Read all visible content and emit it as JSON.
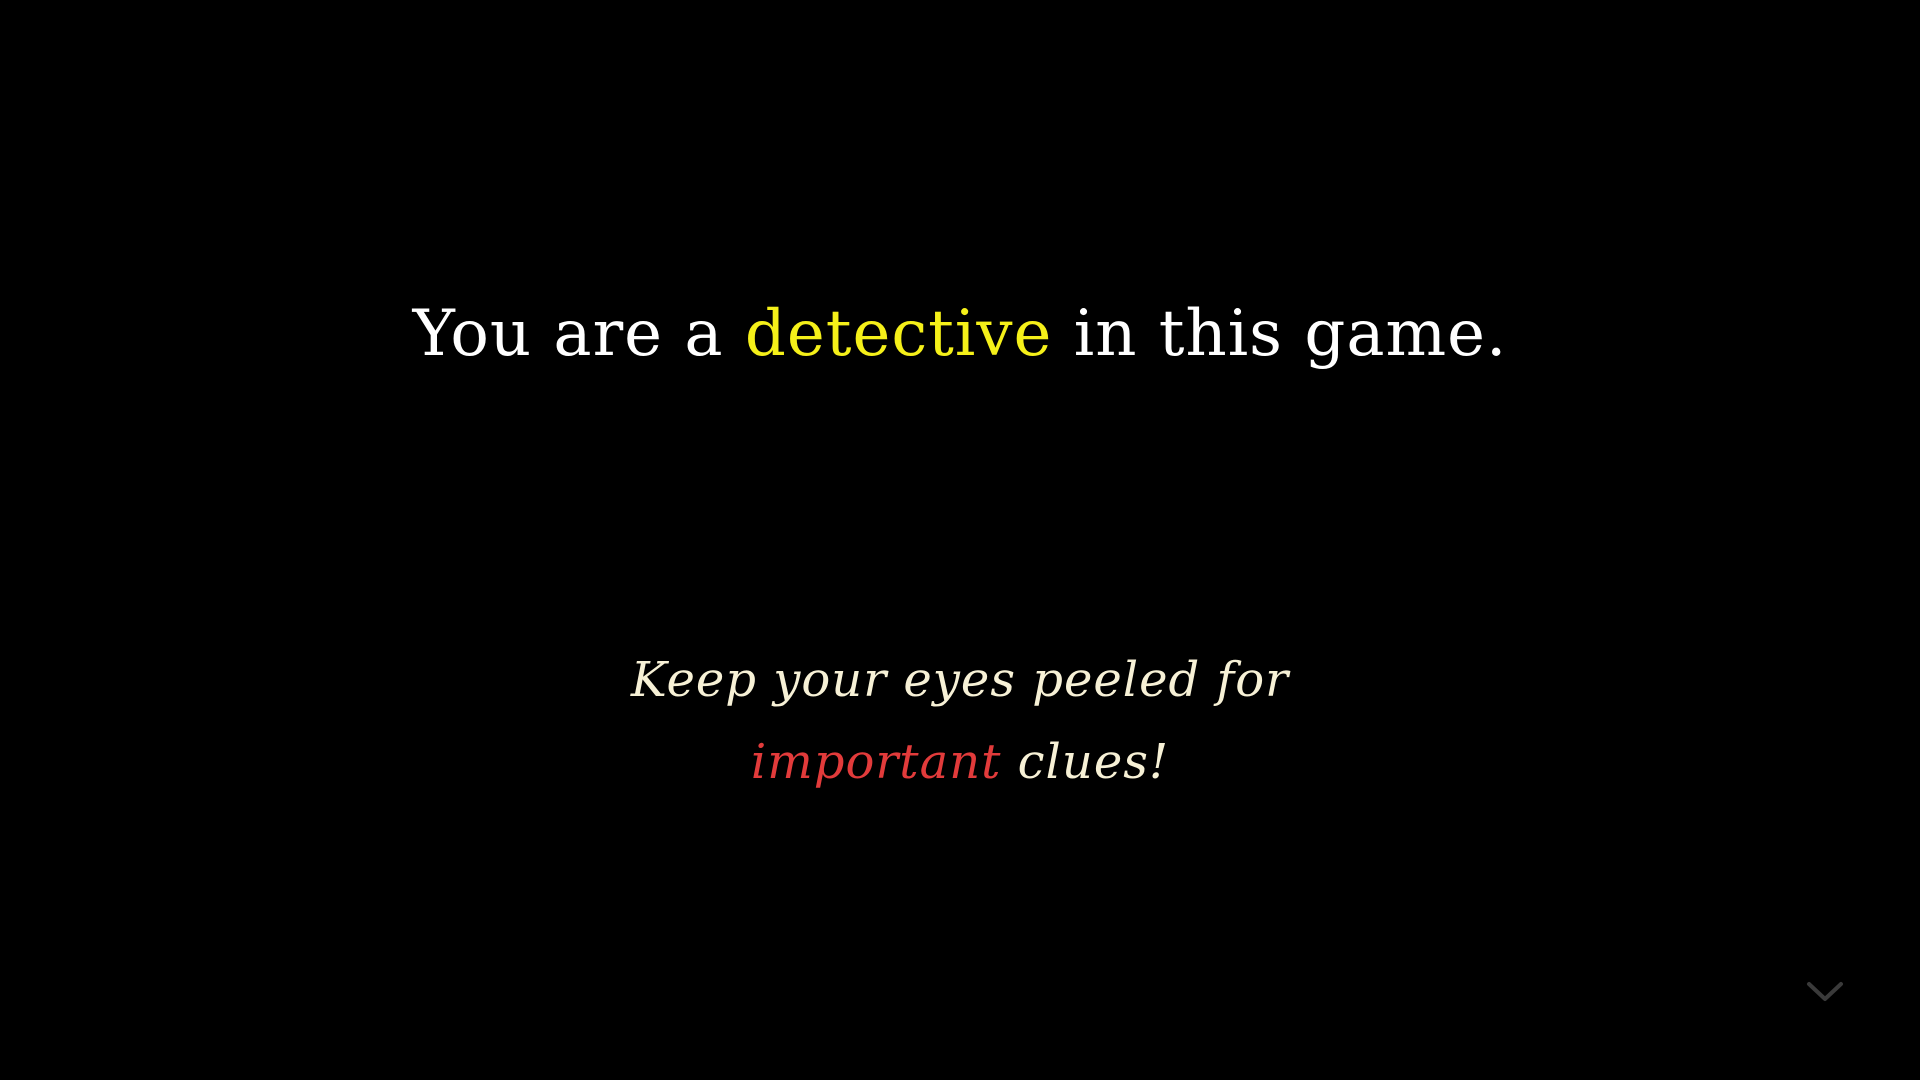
{
  "headline": {
    "before": "You are a ",
    "highlight": "detective",
    "after": " in this game."
  },
  "hint": {
    "line1": "Keep your eyes peeled for",
    "line2_highlight": "important",
    "line2_after": " clues!"
  },
  "navigation": {
    "next_icon": "chevron-down-icon"
  },
  "colors": {
    "background": "#000000",
    "headline_text": "#ffffff",
    "headline_highlight": "#f5f019",
    "hint_text": "#f7f1d6",
    "hint_highlight": "#e23b3b",
    "arrow": "#3a3a3a"
  }
}
